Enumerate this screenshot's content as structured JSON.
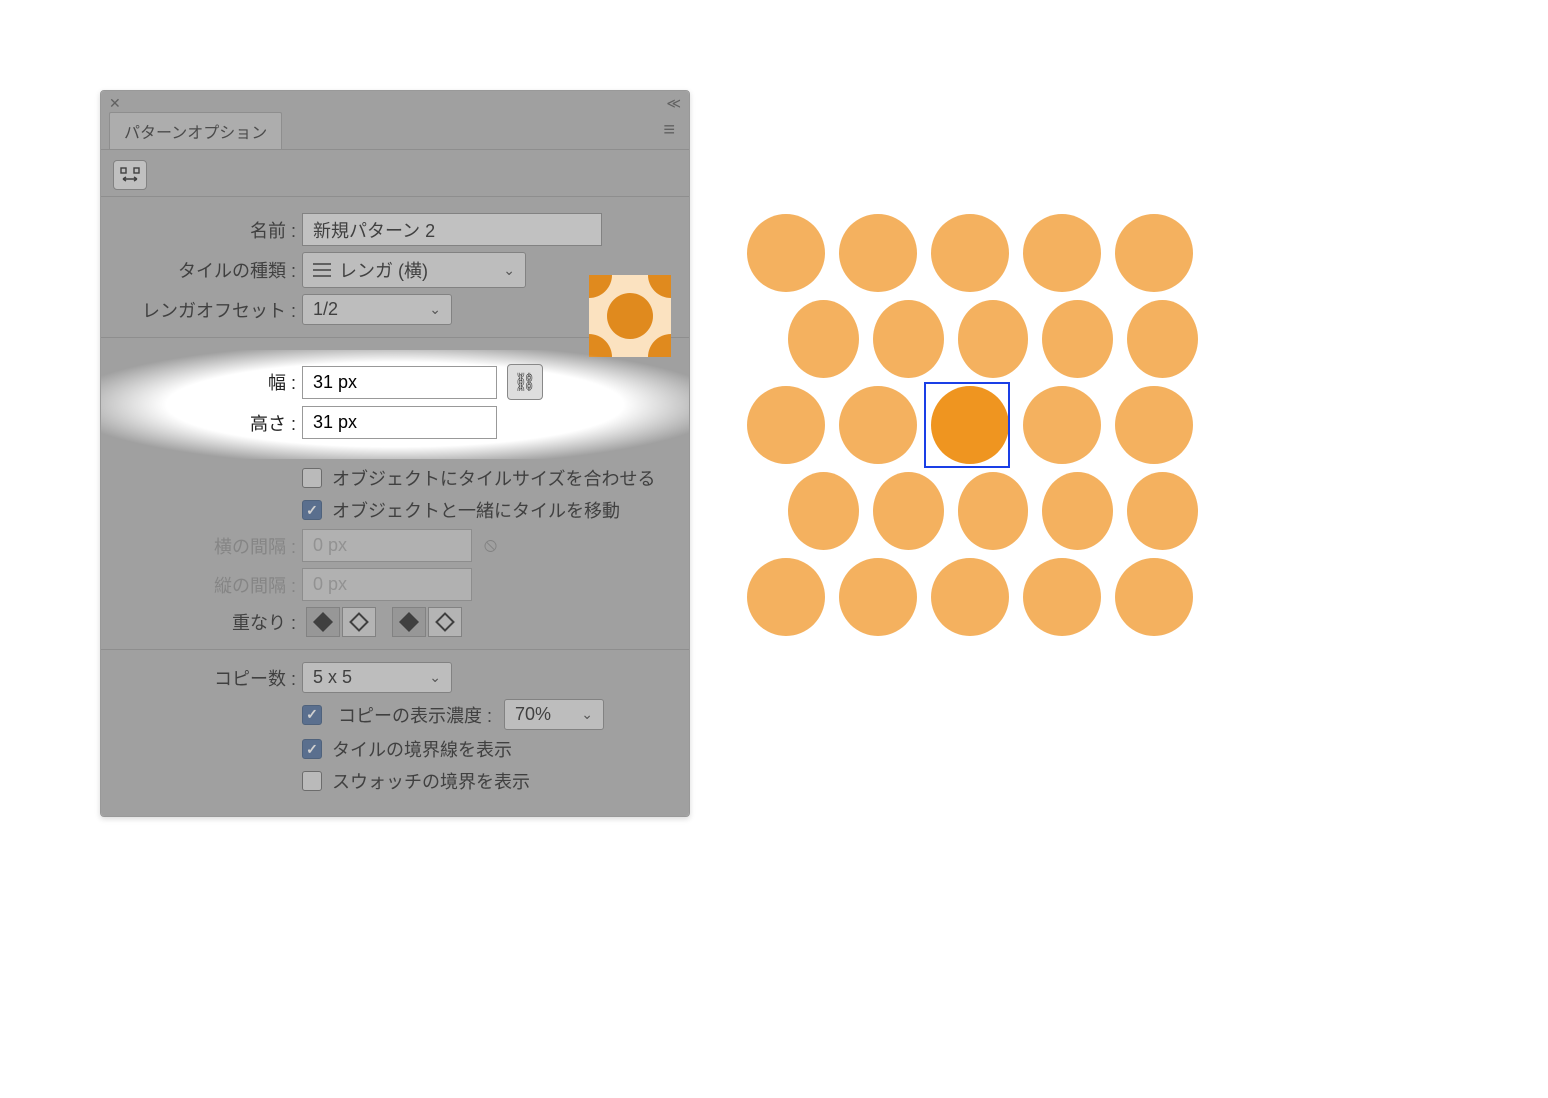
{
  "panel": {
    "title": "パターンオプション",
    "name_label": "名前 :",
    "name_value": "新規パターン 2",
    "tiletype_label": "タイルの種類 :",
    "tiletype_value": "レンガ (横)",
    "offset_label": "レンガオフセット :",
    "offset_value": "1/2",
    "width_label": "幅 :",
    "width_value": "31 px",
    "height_label": "高さ :",
    "height_value": "31 px",
    "fit_tile_label": "オブジェクトにタイルサイズを合わせる",
    "fit_tile_checked": false,
    "move_tile_label": "オブジェクトと一緒にタイルを移動",
    "move_tile_checked": true,
    "hgap_label": "横の間隔 :",
    "hgap_value": "0 px",
    "vgap_label": "縦の間隔 :",
    "vgap_value": "0 px",
    "overlap_label": "重なり :",
    "copies_label": "コピー数 :",
    "copies_value": "5 x 5",
    "opacity_label": "コピーの表示濃度 :",
    "opacity_value": "70%",
    "opacity_checked": true,
    "show_tile_edge_label": "タイルの境界線を表示",
    "show_tile_edge_checked": true,
    "show_swatch_bounds_label": "スウォッチの境界を表示",
    "show_swatch_bounds_checked": false
  }
}
